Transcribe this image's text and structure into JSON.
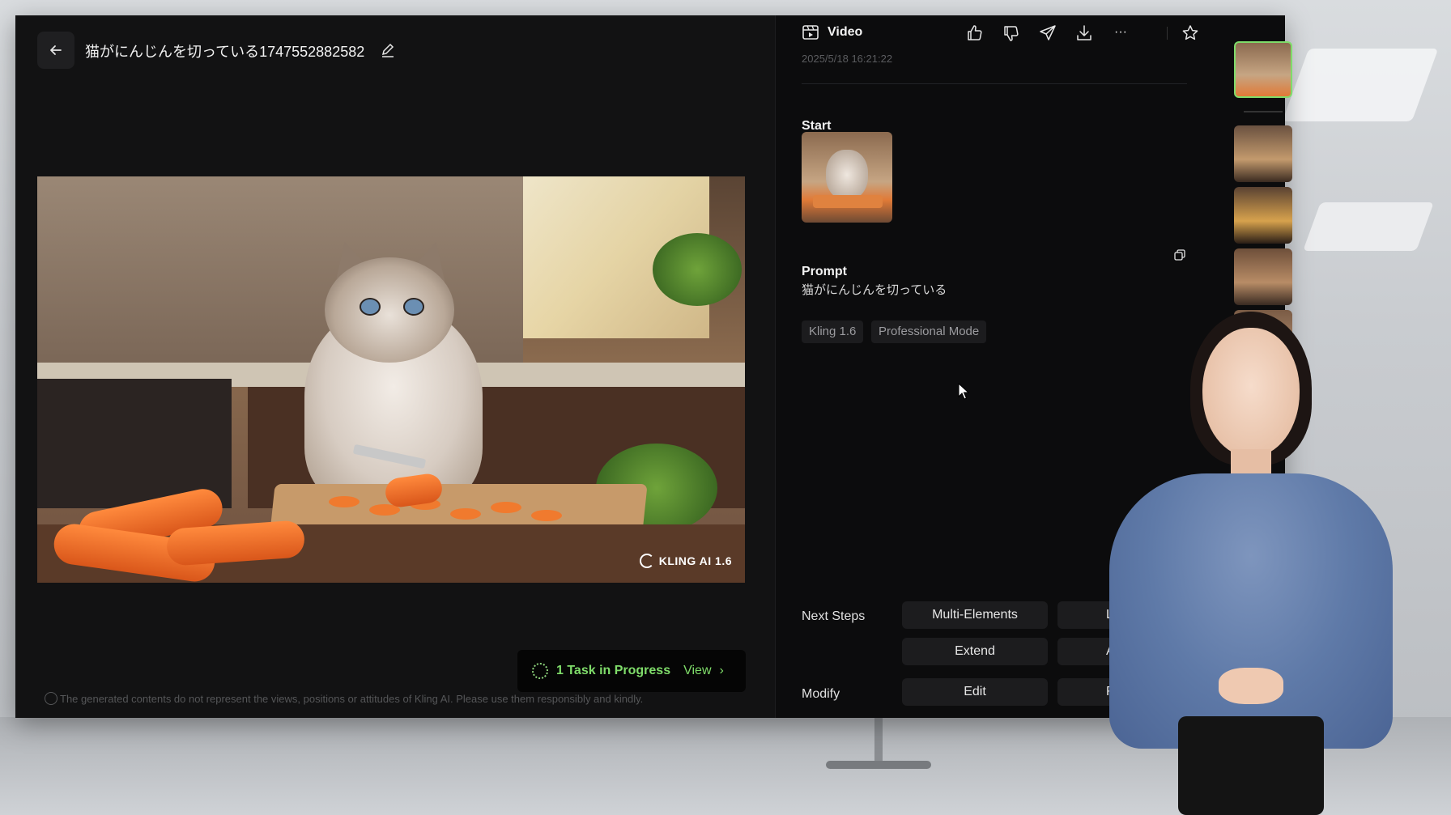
{
  "header": {
    "title": "猫がにんじんを切っている1747552882582"
  },
  "video": {
    "watermark": "KLING AI 1.6"
  },
  "task_status": {
    "text": "1 Task in Progress",
    "view_label": "View",
    "chevron": "›"
  },
  "disclaimer": "The generated contents do not represent the views, positions or attitudes of Kling AI. Please use them responsibly and kindly.",
  "detail": {
    "type_label": "Video",
    "date": "2025/5/18 16:21:22",
    "actions": [
      "thumbs-up-icon",
      "thumbs-down-icon",
      "send-icon",
      "download-icon",
      "more-icon"
    ],
    "more_glyph": "···",
    "start_label": "Start",
    "prompt_label": "Prompt",
    "prompt_text": "猫がにんじんを切っている",
    "tags": [
      "Kling 1.6",
      "Professional Mode"
    ],
    "next_steps_label": "Next Steps",
    "next_steps": {
      "multi_elements": "Multi-Elements",
      "lip": "Lip",
      "extend": "Extend",
      "ai_partial": "AI S"
    },
    "modify_label": "Modify",
    "modify": {
      "edit": "Edit",
      "retry_partial": "Retr"
    }
  },
  "colors": {
    "accent_green": "#7fdc6a",
    "panel_bg": "#0c0c0d",
    "button_bg": "#1c1c1e"
  }
}
